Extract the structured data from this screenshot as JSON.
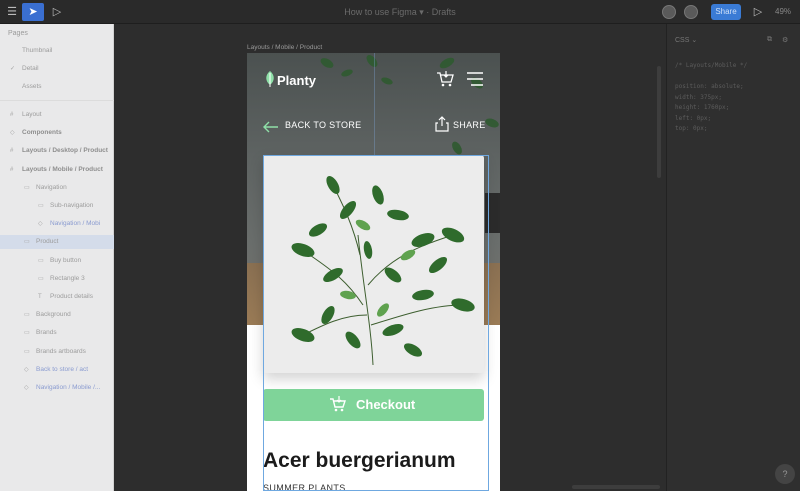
{
  "toolbar": {
    "title": "How to use Figma ▾  ·  Drafts",
    "share_label": "Share",
    "zoom": "49%",
    "accent": "#3a7bd5"
  },
  "layers": {
    "heading": "Pages",
    "pages": [
      {
        "label": "Thumbnail",
        "glyph": ""
      },
      {
        "label": "Detail",
        "glyph": "✓"
      },
      {
        "label": "Assets",
        "glyph": ""
      }
    ],
    "items": [
      {
        "label": "Layout",
        "glyph": "#",
        "indent": 0,
        "style": "normal"
      },
      {
        "label": "Components",
        "glyph": "◇",
        "indent": 0,
        "style": "bold"
      },
      {
        "label": "Layouts / Desktop / Product",
        "glyph": "#",
        "indent": 0,
        "style": "bold"
      },
      {
        "label": "Layouts / Mobile / Product",
        "glyph": "#",
        "indent": 0,
        "style": "bold"
      },
      {
        "label": "Navigation",
        "glyph": "▭",
        "indent": 1,
        "style": "normal"
      },
      {
        "label": "Sub-navigation",
        "glyph": "▭",
        "indent": 2,
        "style": "normal"
      },
      {
        "label": "Navigation / Mobi",
        "glyph": "◇",
        "indent": 2,
        "style": "accent"
      },
      {
        "label": "Product",
        "glyph": "▭",
        "indent": 1,
        "style": "normal"
      },
      {
        "label": "Buy button",
        "glyph": "▭",
        "indent": 2,
        "style": "normal"
      },
      {
        "label": "Rectangle 3",
        "glyph": "▭",
        "indent": 2,
        "style": "normal"
      },
      {
        "label": "Product details",
        "glyph": "T",
        "indent": 2,
        "style": "normal"
      },
      {
        "label": "Background",
        "glyph": "▭",
        "indent": 1,
        "style": "normal"
      },
      {
        "label": "Brands",
        "glyph": "▭",
        "indent": 1,
        "style": "normal"
      },
      {
        "label": "Brands artboards",
        "glyph": "▭",
        "indent": 1,
        "style": "normal"
      },
      {
        "label": "Back to store / act",
        "glyph": "◇",
        "indent": 1,
        "style": "accent"
      },
      {
        "label": "Navigation / Mobile /...",
        "glyph": "◇",
        "indent": 1,
        "style": "accent"
      }
    ]
  },
  "canvas": {
    "frame_label": "Layouts / Mobile / Product"
  },
  "mobile": {
    "brand": "Planty",
    "back_label": "BACK TO STORE",
    "share_label": "SHARE",
    "checkout_label": "Checkout",
    "product_name": "Acer buergerianum",
    "product_category": "SUMMER PLANTS",
    "checkout_color": "#7fd499"
  },
  "inspector": {
    "tab_label": "CSS ⌄",
    "code_lines": [
      "/* Layouts/Mobile */",
      "",
      "position: absolute;",
      "width: 375px;",
      "height: 1760px;",
      "left: 0px;",
      "top: 0px;"
    ]
  }
}
